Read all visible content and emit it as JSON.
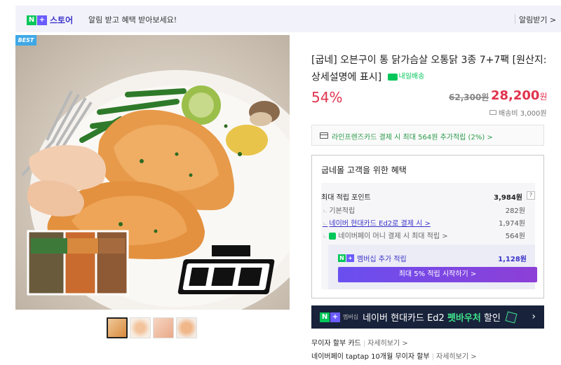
{
  "topbar": {
    "brand": "스토어",
    "message": "알림 받고 혜택 받아보세요!",
    "alarm": "알림받기 >"
  },
  "image": {
    "badge": "BEST",
    "thumbnail_count": 4,
    "selected_thumbnail": 0
  },
  "product": {
    "title": "[굽네] 오븐구이 통 닭가슴살 오통닭 3종 7+7팩 [원산지:상세설명에 표시]",
    "delivery_badge": "내일배송",
    "discount": "54%",
    "original_price": "62,300원",
    "price": "28,200",
    "price_unit": "원",
    "shipping": "배송비 3,000원"
  },
  "card_promo": {
    "text": "라인프렌즈카드 결제 시 최대 564원 추가적립 (2%) >"
  },
  "benefit": {
    "heading": "굽네몰 고객을 위한 혜택",
    "max_points_label": "최대 적립 포인트",
    "max_points_value": "3,984원",
    "info": "?",
    "rows": [
      {
        "label": "기본적립",
        "value": "282원"
      },
      {
        "label": "네이버 현대카드 Ed2로 결제 시 >",
        "value": "1,974원"
      },
      {
        "label": "네이버페이 머니 결제 시 최대 적립 >",
        "value": "564원"
      }
    ],
    "member_label": "멤버십 추가 적립",
    "member_value": "1,128원",
    "member_button": "최대 5% 적립 시작하기 >"
  },
  "ad": {
    "tag": "멤버십",
    "text_prefix": "네이버 현대카드 Ed2 ",
    "text_highlight": "펫바우처",
    "text_suffix": " 할인"
  },
  "footer": {
    "line1_label": "무이자 할부 카드",
    "line1_more": "자세히보기 >",
    "line2_label": "네이버페이 taptap 10개월 무이자 할부",
    "line2_more": "자세히보기 >"
  },
  "colors": {
    "accent_red": "#e0334c",
    "naver_green": "#03c75a",
    "naver_purple": "#3a33c9"
  }
}
